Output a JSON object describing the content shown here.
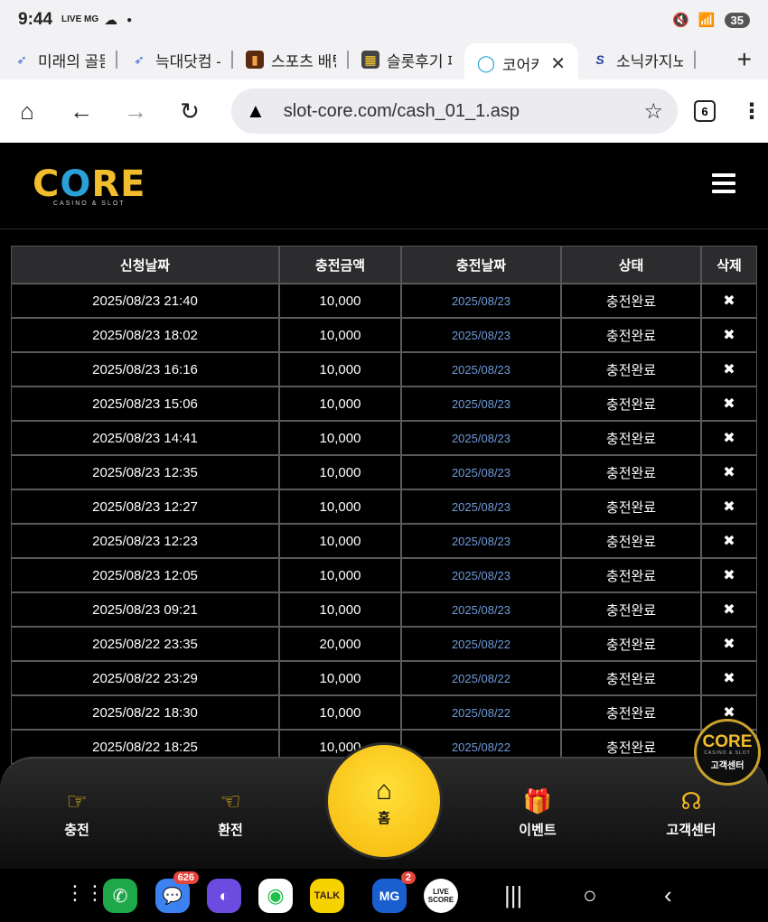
{
  "status_bar": {
    "time": "9:44",
    "live_label": "LIVE MG",
    "battery": "35"
  },
  "tabs": [
    {
      "label": "미래의 골뜸",
      "icon": "blue-bird-icon",
      "active": false
    },
    {
      "label": "늑대닷컴 -",
      "icon": "blue-bird-icon",
      "active": false
    },
    {
      "label": "스포츠 배팅",
      "icon": "sports-icon",
      "active": false
    },
    {
      "label": "슬롯후기 페",
      "icon": "slot-icon",
      "active": false
    },
    {
      "label": "코어카지",
      "icon": "core-ring-icon",
      "active": true
    },
    {
      "label": "소닉카지노",
      "icon": "sonic-s-icon",
      "active": false
    }
  ],
  "address_bar": {
    "url": "slot-core.com/cash_01_1.asp",
    "tab_count": "6"
  },
  "site": {
    "logo_word": "CORE",
    "logo_sub": "CASINO & SLOT"
  },
  "table": {
    "headers": [
      "신청날짜",
      "충전금액",
      "충전날짜",
      "상태",
      "삭제"
    ],
    "rows": [
      {
        "request_date": "2025/08/23 21:40",
        "amount": "10,000",
        "charge_date": "2025/08/23",
        "status": "충전완료",
        "delete": "✖"
      },
      {
        "request_date": "2025/08/23 18:02",
        "amount": "10,000",
        "charge_date": "2025/08/23",
        "status": "충전완료",
        "delete": "✖"
      },
      {
        "request_date": "2025/08/23 16:16",
        "amount": "10,000",
        "charge_date": "2025/08/23",
        "status": "충전완료",
        "delete": "✖"
      },
      {
        "request_date": "2025/08/23 15:06",
        "amount": "10,000",
        "charge_date": "2025/08/23",
        "status": "충전완료",
        "delete": "✖"
      },
      {
        "request_date": "2025/08/23 14:41",
        "amount": "10,000",
        "charge_date": "2025/08/23",
        "status": "충전완료",
        "delete": "✖"
      },
      {
        "request_date": "2025/08/23 12:35",
        "amount": "10,000",
        "charge_date": "2025/08/23",
        "status": "충전완료",
        "delete": "✖"
      },
      {
        "request_date": "2025/08/23 12:27",
        "amount": "10,000",
        "charge_date": "2025/08/23",
        "status": "충전완료",
        "delete": "✖"
      },
      {
        "request_date": "2025/08/23 12:23",
        "amount": "10,000",
        "charge_date": "2025/08/23",
        "status": "충전완료",
        "delete": "✖"
      },
      {
        "request_date": "2025/08/23 12:05",
        "amount": "10,000",
        "charge_date": "2025/08/23",
        "status": "충전완료",
        "delete": "✖"
      },
      {
        "request_date": "2025/08/23 09:21",
        "amount": "10,000",
        "charge_date": "2025/08/23",
        "status": "충전완료",
        "delete": "✖"
      },
      {
        "request_date": "2025/08/22 23:35",
        "amount": "20,000",
        "charge_date": "2025/08/22",
        "status": "충전완료",
        "delete": "✖"
      },
      {
        "request_date": "2025/08/22 23:29",
        "amount": "10,000",
        "charge_date": "2025/08/22",
        "status": "충전완료",
        "delete": "✖"
      },
      {
        "request_date": "2025/08/22 18:30",
        "amount": "10,000",
        "charge_date": "2025/08/22",
        "status": "충전완료",
        "delete": "✖"
      },
      {
        "request_date": "2025/08/22 18:25",
        "amount": "10,000",
        "charge_date": "2025/08/22",
        "status": "충전완료",
        "delete": "✖"
      }
    ]
  },
  "bottom_nav": {
    "charge": "충전",
    "exchange": "환전",
    "home": "홈",
    "event": "이벤트",
    "support": "고객센터"
  },
  "support_badge": {
    "word": "CORE",
    "sub": "CASINO & SLOT",
    "label": "고객센터"
  },
  "dock": {
    "messages_badge": "626",
    "mg_badge": "2",
    "kakao_label": "TALK",
    "mg_label": "MG",
    "livescore_label": "LIVE SCORE"
  },
  "colors": {
    "accent_gold": "#f3bb1e",
    "logo_blue": "#2aa0d8",
    "charge_date_blue": "#6f9ad8"
  }
}
